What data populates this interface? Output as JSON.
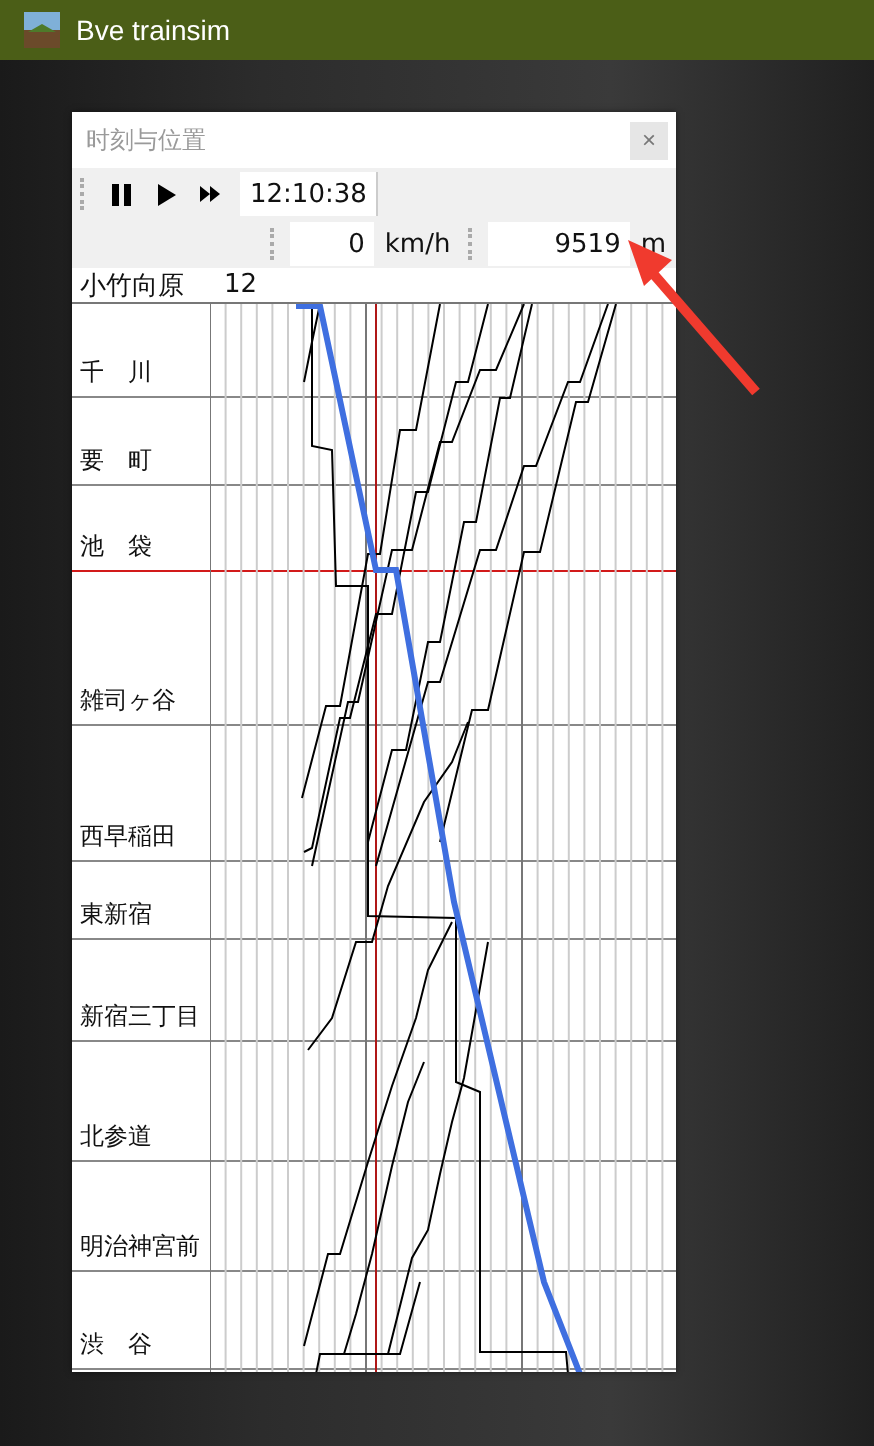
{
  "window": {
    "title": "Bve trainsim"
  },
  "panel": {
    "title": "时刻与位置",
    "close": "×",
    "time": "12:10:38",
    "speed": "0",
    "speed_unit": "km/h",
    "distance": "9519",
    "distance_unit": "m"
  },
  "diagram": {
    "origin_station": "小竹向原",
    "origin_value": "12",
    "stations": [
      {
        "name": "千　川",
        "current": false
      },
      {
        "name": "要　町",
        "current": false
      },
      {
        "name": "池　袋",
        "current": true
      },
      {
        "name": "雑司ヶ谷",
        "current": false
      },
      {
        "name": "西早稲田",
        "current": false
      },
      {
        "name": "東新宿",
        "current": false
      },
      {
        "name": "新宿三丁目",
        "current": false
      },
      {
        "name": "北参道",
        "current": false
      },
      {
        "name": "明治神宮前",
        "current": false
      },
      {
        "name": "渋　谷",
        "current": false
      }
    ]
  }
}
